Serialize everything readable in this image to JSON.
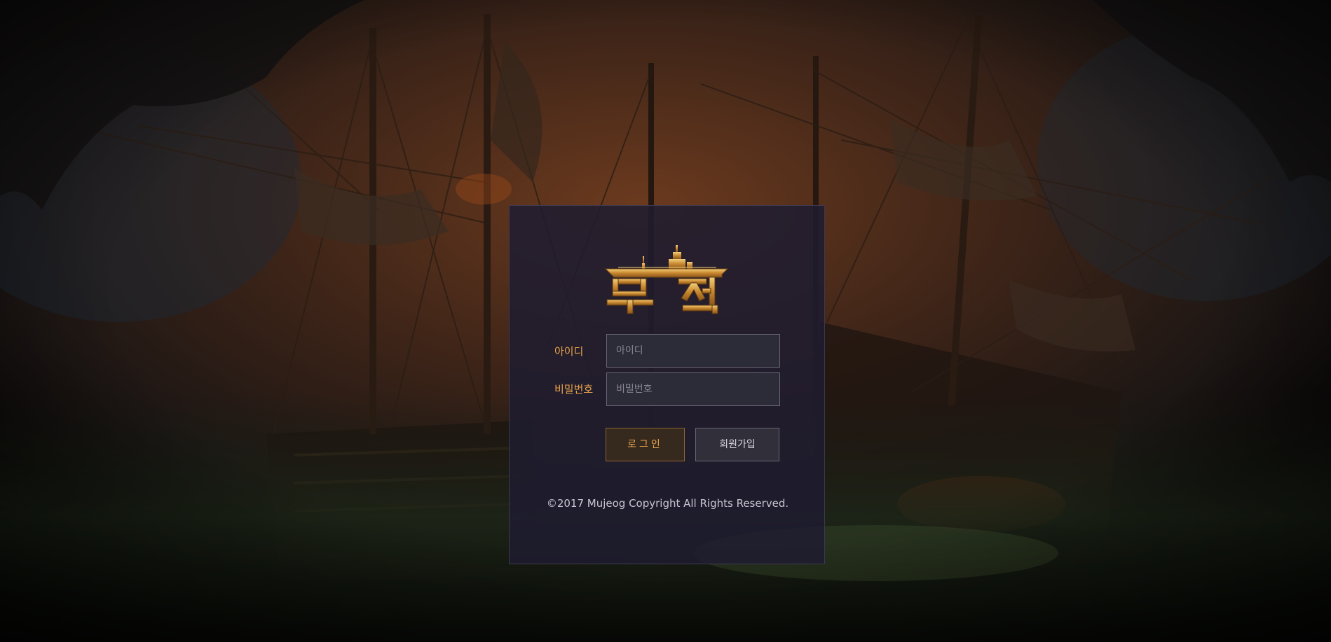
{
  "login": {
    "id_label": "아이디",
    "id_placeholder": "아이디",
    "id_value": "",
    "password_label": "비밀번호",
    "password_placeholder": "비밀번호",
    "password_value": "",
    "login_button": "로그인",
    "signup_button": "회원가입"
  },
  "logo": {
    "text": "무적",
    "icon": "battleship-icon"
  },
  "footer": {
    "copyright": "©2017 Mujeog Copyright All Rights Reserved."
  },
  "colors": {
    "accent": "#e8a24a",
    "panel": "#1e1c30",
    "field_bg": "#2c2b38",
    "login_button_bg": "#36291e",
    "login_button_border": "#8c6537"
  }
}
